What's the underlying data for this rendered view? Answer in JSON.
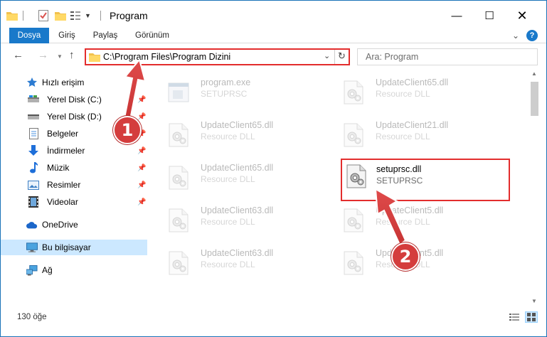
{
  "window": {
    "title": "Program",
    "controls": {
      "minimize": "—",
      "maximize": "☐",
      "close": "✕"
    }
  },
  "ribbon": {
    "tabs": [
      "Dosya",
      "Giriş",
      "Paylaş",
      "Görünüm"
    ],
    "accent": "#1979ca",
    "help": "?"
  },
  "nav": {
    "address": "C:\\Program Files\\Program Dizini",
    "search_placeholder": "Ara: Program"
  },
  "sidebar": {
    "quick_access": "Hızlı erişim",
    "items": [
      {
        "label": "Yerel Disk (C:)",
        "icon": "disk-icon",
        "pinned": true
      },
      {
        "label": "Yerel Disk (D:)",
        "icon": "disk-icon",
        "pinned": true
      },
      {
        "label": "Belgeler",
        "icon": "documents-icon",
        "pinned": true
      },
      {
        "label": "İndirmeler",
        "icon": "download-icon",
        "pinned": true
      },
      {
        "label": "Müzik",
        "icon": "music-icon",
        "pinned": true
      },
      {
        "label": "Resimler",
        "icon": "pictures-icon",
        "pinned": true
      },
      {
        "label": "Videolar",
        "icon": "video-icon",
        "pinned": true
      }
    ],
    "onedrive": "OneDrive",
    "this_pc": "Bu bilgisayar",
    "network": "Ağ"
  },
  "files": [
    {
      "name": "program.exe",
      "desc": "SETUPRSC",
      "type": "exe",
      "faded": true
    },
    {
      "name": "UpdateClient65.dll",
      "desc": "Resource DLL",
      "type": "dll",
      "faded": true
    },
    {
      "name": "UpdateClient65.dll",
      "desc": "Resource DLL",
      "type": "dll",
      "faded": true
    },
    {
      "name": "UpdateClient21.dll",
      "desc": "Resource DLL",
      "type": "dll",
      "faded": true
    },
    {
      "name": "UpdateClient65.dll",
      "desc": "Resource DLL",
      "type": "dll",
      "faded": true
    },
    {
      "name": "setuprsc.dll",
      "desc": "SETUPRSC",
      "type": "dll",
      "faded": false,
      "highlighted": true
    },
    {
      "name": "UpdateClient63.dll",
      "desc": "Resource DLL",
      "type": "dll",
      "faded": true
    },
    {
      "name": "UpdateClient5.dll",
      "desc": "Resource DLL",
      "type": "dll",
      "faded": true
    },
    {
      "name": "UpdateClient63.dll",
      "desc": "Resource DLL",
      "type": "dll",
      "faded": true
    },
    {
      "name": "UpdateClient5.dll",
      "desc": "Resource DLL",
      "type": "dll",
      "faded": true
    }
  ],
  "status": {
    "count": "130 öğe"
  },
  "annotations": {
    "step1": "1",
    "step2": "2",
    "color": "#d43d3d"
  }
}
